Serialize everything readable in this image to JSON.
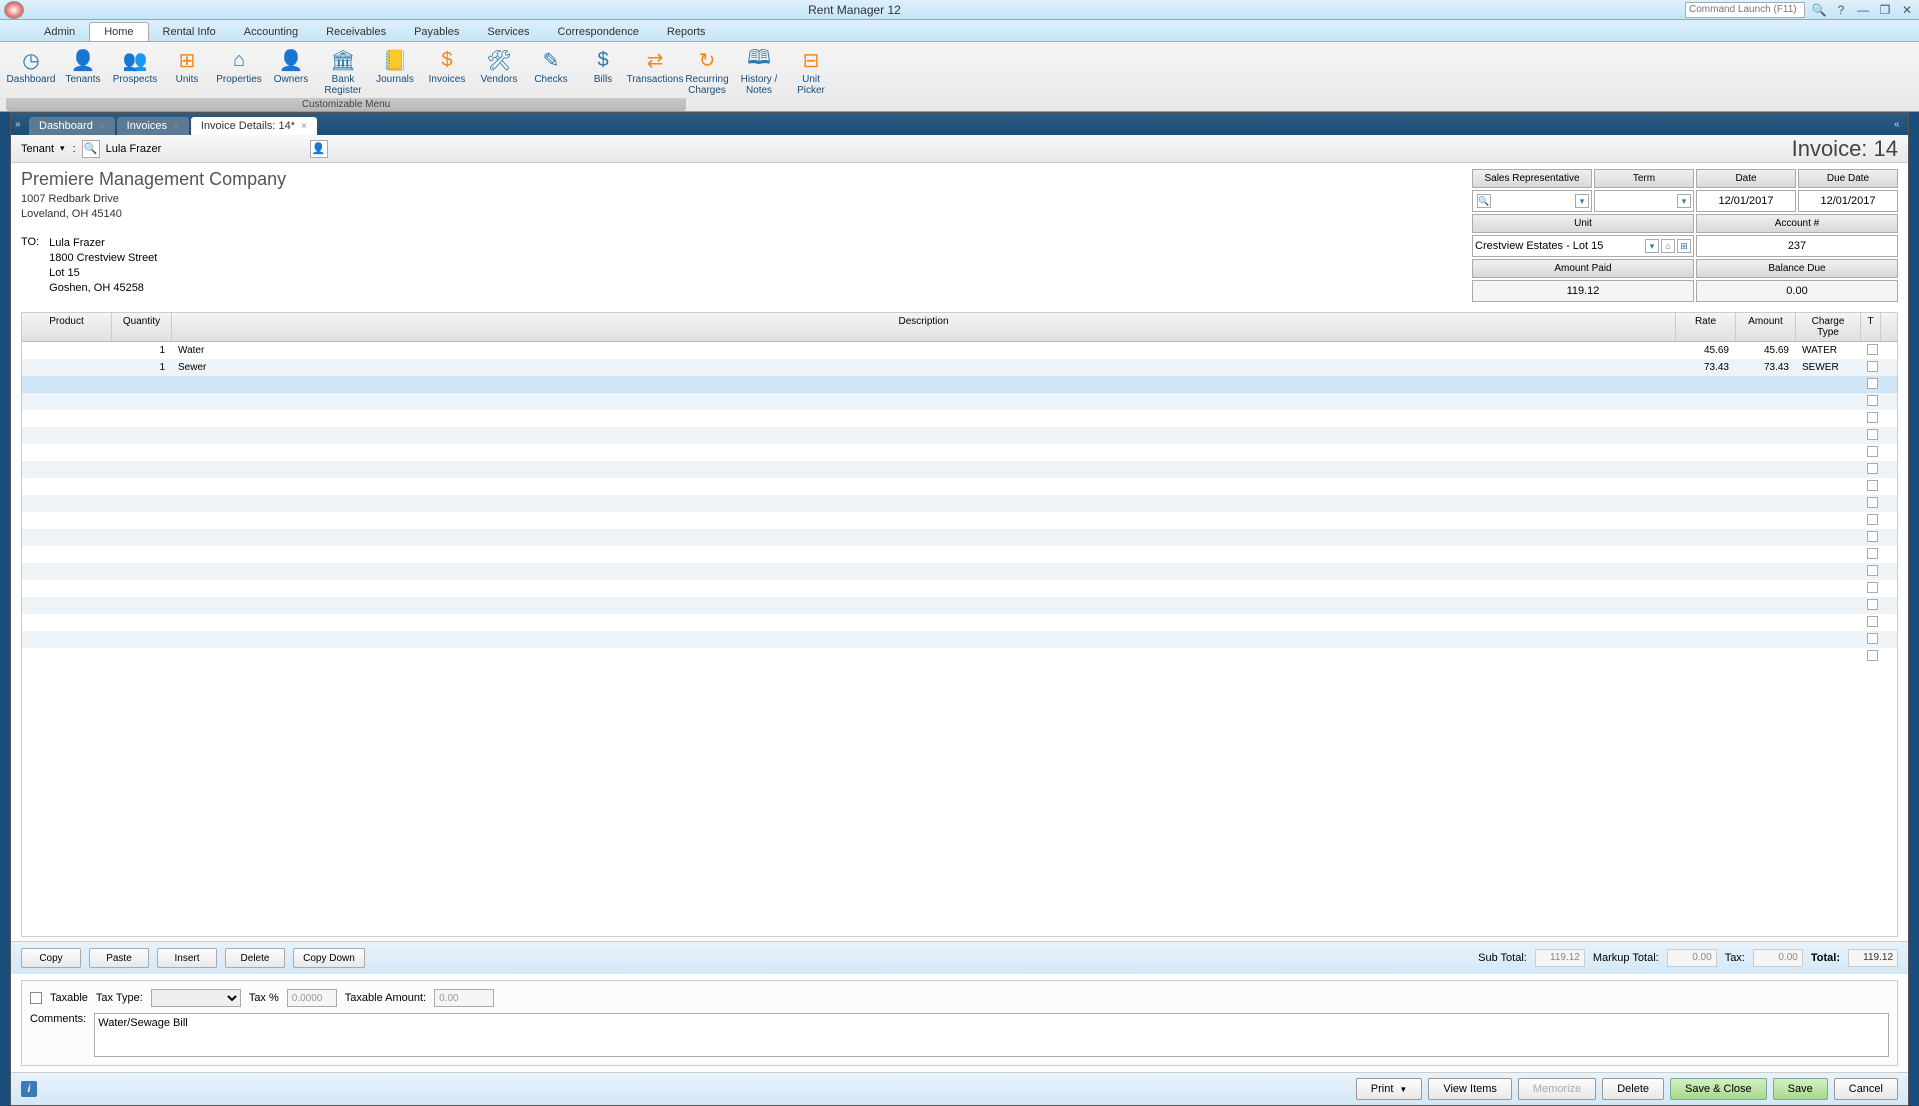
{
  "app": {
    "title": "Rent Manager 12",
    "command_placeholder": "Command Launch (F11)"
  },
  "menu": {
    "items": [
      "Admin",
      "Home",
      "Rental Info",
      "Accounting",
      "Receivables",
      "Payables",
      "Services",
      "Correspondence",
      "Reports"
    ],
    "active": 1
  },
  "toolbar": {
    "items": [
      {
        "label": "Dashboard",
        "glyph": "◷",
        "cls": "blue"
      },
      {
        "label": "Tenants",
        "glyph": "👤",
        "cls": "blue"
      },
      {
        "label": "Prospects",
        "glyph": "👥",
        "cls": "orange"
      },
      {
        "label": "Units",
        "glyph": "⊞",
        "cls": "orange"
      },
      {
        "label": "Properties",
        "glyph": "⌂",
        "cls": "blue"
      },
      {
        "label": "Owners",
        "glyph": "👤",
        "cls": "orange"
      },
      {
        "label": "Bank Register",
        "glyph": "🏛",
        "cls": "blue"
      },
      {
        "label": "Journals",
        "glyph": "📒",
        "cls": "orange"
      },
      {
        "label": "Invoices",
        "glyph": "$",
        "cls": "orange"
      },
      {
        "label": "Vendors",
        "glyph": "🛠",
        "cls": "blue"
      },
      {
        "label": "Checks",
        "glyph": "✎",
        "cls": "blue"
      },
      {
        "label": "Bills",
        "glyph": "$",
        "cls": "blue"
      },
      {
        "label": "Transactions",
        "glyph": "⇄",
        "cls": "orange"
      },
      {
        "label": "Recurring Charges",
        "glyph": "↻",
        "cls": "orange"
      },
      {
        "label": "History / Notes",
        "glyph": "🕮",
        "cls": "blue"
      },
      {
        "label": "Unit Picker",
        "glyph": "⊟",
        "cls": "orange"
      }
    ],
    "caption": "Customizable Menu"
  },
  "tabs": {
    "items": [
      "Dashboard",
      "Invoices",
      "Invoice Details: 14*"
    ],
    "active": 2
  },
  "filter": {
    "type_label": "Tenant",
    "name": "Lula Frazer",
    "title": "Invoice: 14"
  },
  "company": {
    "name": "Premiere Management Company",
    "addr1": "1007 Redbark Drive",
    "addr2": "Loveland, OH 45140",
    "to_label": "TO:",
    "to_name": "Lula Frazer",
    "to_addr1": "1800 Crestview Street",
    "to_addr2": "Lot 15",
    "to_addr3": "Goshen, OH 45258"
  },
  "inv": {
    "hd_salesrep": "Sales Representative",
    "hd_term": "Term",
    "hd_date": "Date",
    "hd_due": "Due Date",
    "date": "12/01/2017",
    "due": "12/01/2017",
    "hd_unit": "Unit",
    "hd_acct": "Account #",
    "unit": "Crestview Estates - Lot 15",
    "acct": "237",
    "hd_paid": "Amount Paid",
    "hd_bal": "Balance Due",
    "paid": "119.12",
    "bal": "0.00"
  },
  "cols": {
    "product": "Product",
    "quantity": "Quantity",
    "description": "Description",
    "rate": "Rate",
    "amount": "Amount",
    "charge_type": "Charge Type",
    "t": "T"
  },
  "lines": [
    {
      "qty": "1",
      "desc": "Water",
      "rate": "45.69",
      "amount": "45.69",
      "ct": "WATER"
    },
    {
      "qty": "1",
      "desc": "Sewer",
      "rate": "73.43",
      "amount": "73.43",
      "ct": "SEWER"
    }
  ],
  "rowbtns": {
    "copy": "Copy",
    "paste": "Paste",
    "insert": "Insert",
    "delete": "Delete",
    "copydown": "Copy Down"
  },
  "totals": {
    "sub_lbl": "Sub Total:",
    "sub": "119.12",
    "markup_lbl": "Markup Total:",
    "markup": "0.00",
    "tax_lbl": "Tax:",
    "tax": "0.00",
    "total_lbl": "Total:",
    "total": "119.12"
  },
  "tax": {
    "taxable": "Taxable",
    "type_lbl": "Tax Type:",
    "pct_lbl": "Tax %",
    "pct": "0.0000",
    "amt_lbl": "Taxable Amount:",
    "amt": "0.00",
    "comments_lbl": "Comments:",
    "comments": "Water/Sewage Bill"
  },
  "footer": {
    "print": "Print",
    "view": "View Items",
    "memorize": "Memorize",
    "delete": "Delete",
    "saveclose": "Save & Close",
    "save": "Save",
    "cancel": "Cancel"
  }
}
